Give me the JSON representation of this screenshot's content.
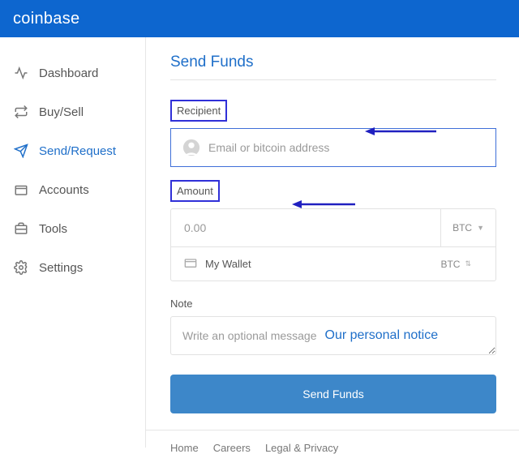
{
  "header": {
    "logo": "coinbase"
  },
  "sidebar": {
    "items": [
      {
        "label": "Dashboard",
        "icon": "pulse-icon"
      },
      {
        "label": "Buy/Sell",
        "icon": "swap-icon"
      },
      {
        "label": "Send/Request",
        "icon": "send-icon",
        "active": true
      },
      {
        "label": "Accounts",
        "icon": "folder-icon"
      },
      {
        "label": "Tools",
        "icon": "briefcase-icon"
      },
      {
        "label": "Settings",
        "icon": "gear-icon"
      }
    ]
  },
  "page": {
    "title": "Send Funds",
    "recipient_label": "Recipient",
    "recipient_placeholder": "Email or bitcoin address",
    "amount_label": "Amount",
    "amount_placeholder": "0.00",
    "amount_currency": "BTC",
    "wallet_name": "My Wallet",
    "wallet_currency": "BTC",
    "note_label": "Note",
    "note_placeholder": "Write an optional message",
    "personal_notice": "Our personal notice",
    "send_button": "Send Funds"
  },
  "footer": {
    "links": [
      "Home",
      "Careers",
      "Legal & Privacy"
    ]
  },
  "annotations": {
    "arrow_color": "#2020c0"
  }
}
